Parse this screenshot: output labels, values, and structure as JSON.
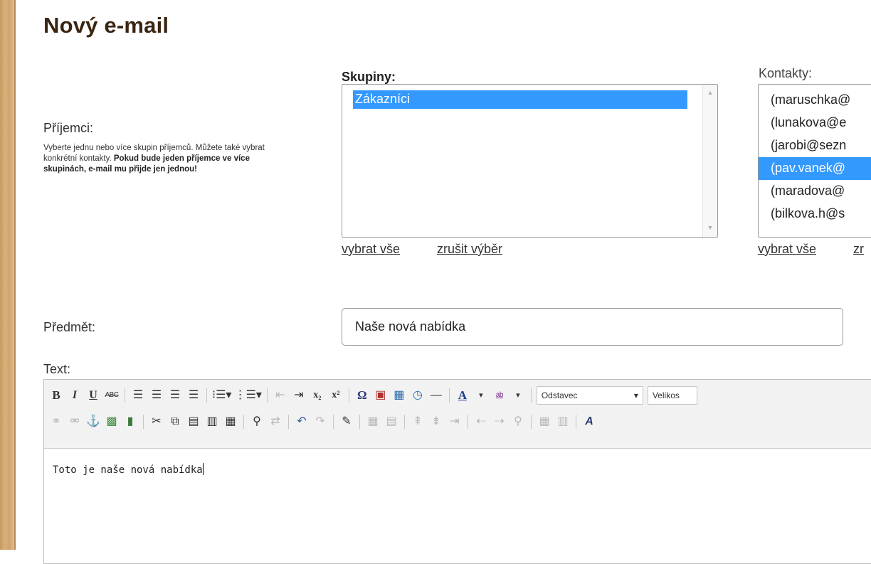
{
  "page": {
    "title": "Nový e-mail"
  },
  "recipients": {
    "label": "Příjemci:",
    "help_plain": "Vyberte jednu nebo více skupin příjemců. Můžete také vybrat konkrétní kontakty. ",
    "help_bold": "Pokud bude jeden příjemce ve více skupinách, e-mail mu přijde jen jednou!"
  },
  "groups": {
    "title": "Skupiny:",
    "items": [
      {
        "label": "Zákazníci",
        "selected": true
      }
    ],
    "select_all": "vybrat vše",
    "clear_selection": "zrušit výběr"
  },
  "contacts": {
    "title": "Kontakty:",
    "items": [
      {
        "label": "(maruschka@",
        "selected": false
      },
      {
        "label": "(lunakova@e",
        "selected": false
      },
      {
        "label": "(jarobi@sezn",
        "selected": false
      },
      {
        "label": "(pav.vanek@",
        "selected": true
      },
      {
        "label": "(maradova@",
        "selected": false
      },
      {
        "label": "(bilkova.h@s",
        "selected": false
      }
    ],
    "select_all": "vybrat vše",
    "clear_selection": "zr"
  },
  "subject": {
    "label": "Předmět:",
    "value": "Naše nová nabídka"
  },
  "text": {
    "label": "Text:",
    "format_select": "Odstavec",
    "size_select": "Velikos",
    "content": "Toto je naše nová nabídka"
  },
  "toolbar": {
    "bold": "B",
    "italic": "I",
    "underline": "U",
    "strike": "ABC",
    "subscript": "x₂",
    "superscript": "x²",
    "omega": "Ω",
    "hr": "—",
    "font_color": "A",
    "highlight": "ab"
  },
  "colors": {
    "accent": "#3399ff",
    "heading": "#3a2512",
    "sidebar": "#d2a872"
  }
}
